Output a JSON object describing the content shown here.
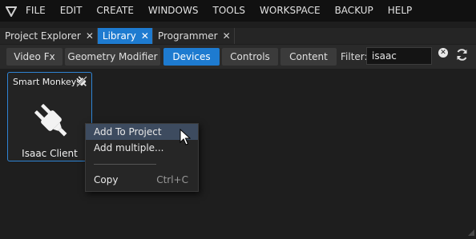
{
  "menubar": {
    "logo_icon": "triangle-logo-icon",
    "items": [
      "FILE",
      "EDIT",
      "CREATE",
      "WINDOWS",
      "TOOLS",
      "WORKSPACE",
      "BACKUP",
      "HELP"
    ]
  },
  "tabs": [
    {
      "label": "Project Explorer",
      "active": false
    },
    {
      "label": "Library",
      "active": true
    },
    {
      "label": "Programmer",
      "active": false
    }
  ],
  "tab_close_glyph": "✕",
  "filters": {
    "buttons": [
      {
        "label": "Video Fx",
        "active": false
      },
      {
        "label": "Geometry Modifier",
        "active": false
      },
      {
        "label": "Devices",
        "active": true
      },
      {
        "label": "Controls",
        "active": false
      },
      {
        "label": "Content",
        "active": false
      }
    ],
    "filter_label": "Filter:",
    "filter_value": "isaac",
    "clear_icon": "clear-icon",
    "refresh_icon": "refresh-icon"
  },
  "card": {
    "title": "Smart Monkeys",
    "tag_icon": "plug-disconnected-icon",
    "main_icon": "plug-icon",
    "label": "Isaac Client"
  },
  "context_menu": {
    "items": [
      {
        "label": "Add To Project",
        "shortcut": "",
        "highlighted": true
      },
      {
        "label": "Add multiple...",
        "shortcut": "",
        "highlighted": false
      },
      {
        "label": "Copy",
        "shortcut": "Ctrl+C",
        "highlighted": false
      }
    ]
  },
  "colors": {
    "accent": "#1e7bd0",
    "background": "#1e1e1e",
    "menubar": "#111111",
    "hover": "#3d4b5f"
  }
}
